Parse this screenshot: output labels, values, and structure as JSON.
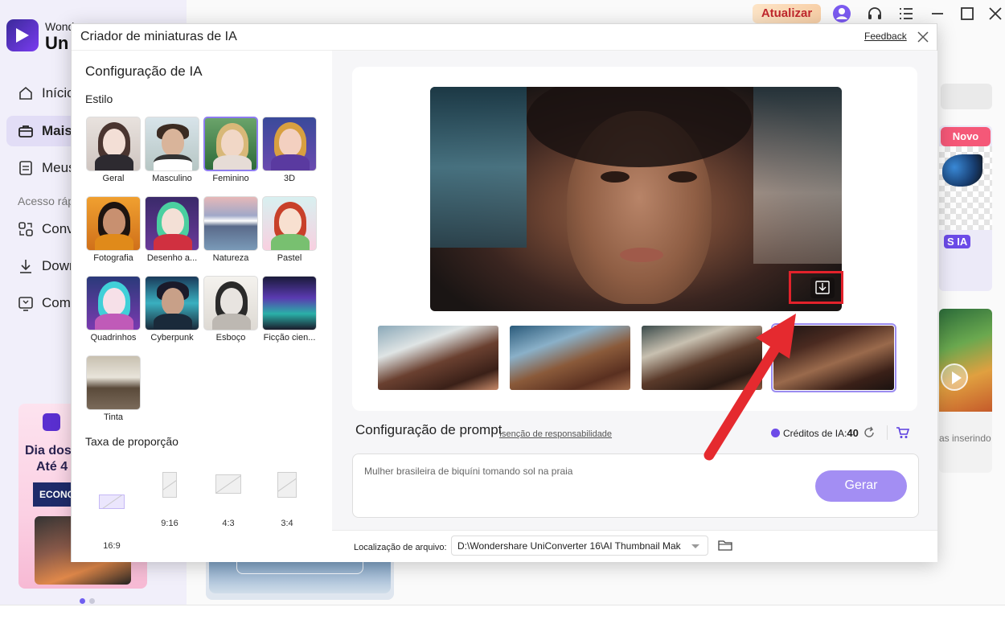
{
  "app": {
    "brand_line1": "Wonde",
    "brand_line2": "Un",
    "nav": [
      {
        "label": "Início"
      },
      {
        "label": "Mais"
      },
      {
        "label": "Meus"
      }
    ],
    "quick_access_label": "Acesso ráp",
    "quick": [
      {
        "label": "Conv"
      },
      {
        "label": "Down"
      },
      {
        "label": "Comp"
      }
    ],
    "promo": {
      "line1": "Dia dos",
      "line2": "Até 4",
      "button": "ECONO"
    },
    "upgrade_label": "Atualizar",
    "right_badge_new": "Novo",
    "right_badge_ia": "S IA",
    "right_card_text": "as inserindo"
  },
  "modal": {
    "title": "Criador de miniaturas de IA",
    "feedback": "Feedback",
    "left": {
      "section_title": "Configuração de IA",
      "style_label": "Estilo",
      "styles": [
        {
          "label": "Geral",
          "selected": false
        },
        {
          "label": "Masculino",
          "selected": false
        },
        {
          "label": "Feminino",
          "selected": true
        },
        {
          "label": "3D",
          "selected": false
        },
        {
          "label": "Fotografia",
          "selected": false
        },
        {
          "label": "Desenho a...",
          "selected": false
        },
        {
          "label": "Natureza",
          "selected": false
        },
        {
          "label": "Pastel",
          "selected": false
        },
        {
          "label": "Quadrinhos",
          "selected": false
        },
        {
          "label": "Cyberpunk",
          "selected": false
        },
        {
          "label": "Esboço",
          "selected": false
        },
        {
          "label": "Ficção cien...",
          "selected": false
        },
        {
          "label": "Tinta",
          "selected": false
        }
      ],
      "ratio_label": "Taxa de proporção",
      "ratios": [
        {
          "label": "16:9",
          "selected": true
        },
        {
          "label": "9:16",
          "selected": false
        },
        {
          "label": "4:3",
          "selected": false
        },
        {
          "label": "3:4",
          "selected": false
        }
      ]
    },
    "right": {
      "prompt_title": "Configuração de prompt",
      "disclaimer": "Isenção de responsabilidade",
      "credits_label": "Créditos de IA:",
      "credits_value": "40",
      "prompt_text": "Mulher brasileira de biquíni tomando sol na praia",
      "generate": "Gerar",
      "file_location_label": "Localização de arquivo:",
      "file_location_value": "D:\\Wondershare UniConverter 16\\AI Thumbnail Mak",
      "selected_variant": 4
    }
  },
  "colors": {
    "accent": "#a38ef3",
    "annotation": "#e2222b",
    "badge_new": "#f55878"
  }
}
